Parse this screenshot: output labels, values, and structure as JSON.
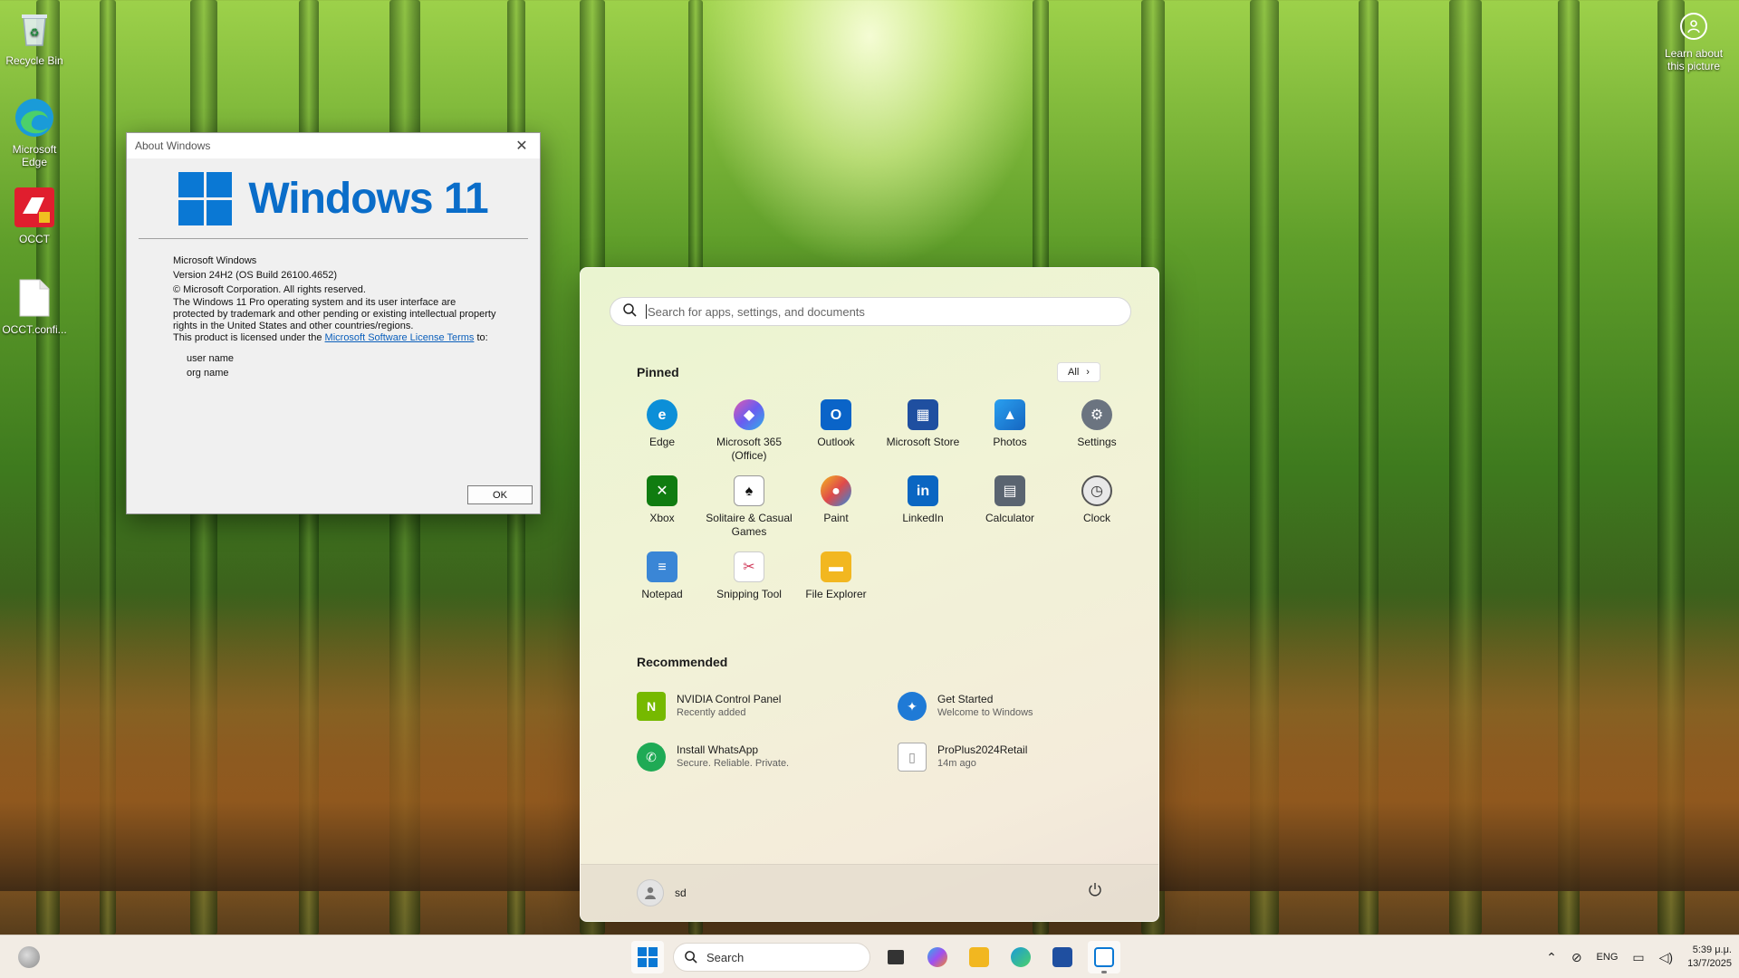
{
  "desktop": {
    "icons": [
      {
        "label": "Recycle Bin"
      },
      {
        "label": "Microsoft Edge"
      },
      {
        "label": "OCCT"
      },
      {
        "label": "OCCT.confi..."
      }
    ],
    "learn_about": "Learn about this picture"
  },
  "about_window": {
    "title": "About Windows",
    "brand": "Windows 11",
    "product": "Microsoft Windows",
    "version": "Version 24H2 (OS Build 26100.4652)",
    "copyright": "© Microsoft Corporation. All rights reserved.",
    "legal": "The Windows 11 Pro operating system and its user interface are protected by trademark and other pending or existing intellectual property rights in the United States and other countries/regions.",
    "license_prefix": "This product is licensed under the ",
    "license_link": "Microsoft Software License Terms",
    "license_suffix": " to:",
    "user_name": "user name",
    "org_name": "org name",
    "ok_label": "OK"
  },
  "start_menu": {
    "search_placeholder": "Search for apps, settings, and documents",
    "pinned_title": "Pinned",
    "all_label": "All",
    "pinned": [
      {
        "label": "Edge",
        "icon": "edge-icon",
        "color": "#0c8fd8"
      },
      {
        "label": "Microsoft 365 (Office)",
        "icon": "m365-icon",
        "color": "#9b5cf0"
      },
      {
        "label": "Outlook",
        "icon": "outlook-icon",
        "color": "#0a64c8"
      },
      {
        "label": "Microsoft Store",
        "icon": "store-icon",
        "color": "#1f4fa0"
      },
      {
        "label": "Photos",
        "icon": "photos-icon",
        "color": "#1e88e5"
      },
      {
        "label": "Settings",
        "icon": "gear-icon",
        "color": "#6b7480"
      },
      {
        "label": "Xbox",
        "icon": "xbox-icon",
        "color": "#107c10"
      },
      {
        "label": "Solitaire & Casual Games",
        "icon": "cards-icon",
        "color": "#2e7bd6"
      },
      {
        "label": "Paint",
        "icon": "palette-icon",
        "color": "#e0a020"
      },
      {
        "label": "LinkedIn",
        "icon": "linkedin-icon",
        "color": "#0a66c2"
      },
      {
        "label": "Calculator",
        "icon": "calculator-icon",
        "color": "#5a6470"
      },
      {
        "label": "Clock",
        "icon": "clock-icon",
        "color": "#4a4a4a"
      },
      {
        "label": "Notepad",
        "icon": "notepad-icon",
        "color": "#3a86d6"
      },
      {
        "label": "Snipping Tool",
        "icon": "scissors-icon",
        "color": "#d03a5a"
      },
      {
        "label": "File Explorer",
        "icon": "folder-icon",
        "color": "#f2b720"
      }
    ],
    "recommended_title": "Recommended",
    "recommended": [
      {
        "title": "NVIDIA Control Panel",
        "subtitle": "Recently added",
        "icon": "nvidia-icon",
        "color": "#76b900"
      },
      {
        "title": "Get Started",
        "subtitle": "Welcome to Windows",
        "icon": "get-started-icon",
        "color": "#1f7ad6"
      },
      {
        "title": "Install WhatsApp",
        "subtitle": "Secure. Reliable. Private.",
        "icon": "whatsapp-icon",
        "color": "#1faa55"
      },
      {
        "title": "ProPlus2024Retail",
        "subtitle": "14m ago",
        "icon": "file-icon",
        "color": "#9a9a9a"
      }
    ],
    "user": "sd"
  },
  "taskbar": {
    "search_label": "Search",
    "language": "ENG",
    "time": "5:39 μ.μ.",
    "date": "13/7/2025"
  }
}
